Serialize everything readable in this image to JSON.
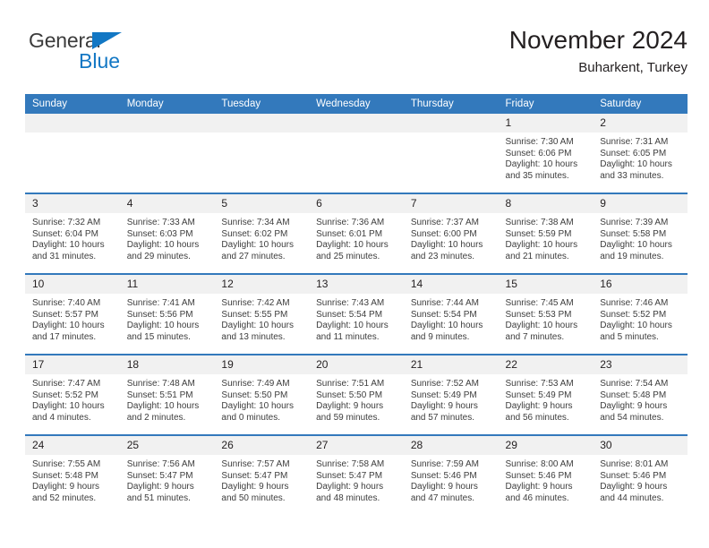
{
  "brand": {
    "name_top": "General",
    "name_bottom": "Blue",
    "triangle_color": "#1277c4",
    "text_color": "#3b3b3b",
    "accent_color": "#1277c4"
  },
  "header": {
    "month_year": "November 2024",
    "location": "Buharkent, Turkey"
  },
  "theme": {
    "header_bg": "#3379bc",
    "header_text": "#ffffff",
    "daynum_bg": "#f1f1f1",
    "row_border": "#3379bc",
    "body_text": "#3d3d3d"
  },
  "weekday_headers": [
    "Sunday",
    "Monday",
    "Tuesday",
    "Wednesday",
    "Thursday",
    "Friday",
    "Saturday"
  ],
  "weeks": [
    [
      {
        "day": "",
        "empty": true
      },
      {
        "day": "",
        "empty": true
      },
      {
        "day": "",
        "empty": true
      },
      {
        "day": "",
        "empty": true
      },
      {
        "day": "",
        "empty": true
      },
      {
        "day": "1",
        "sunrise": "Sunrise: 7:30 AM",
        "sunset": "Sunset: 6:06 PM",
        "daylight": "Daylight: 10 hours and 35 minutes."
      },
      {
        "day": "2",
        "sunrise": "Sunrise: 7:31 AM",
        "sunset": "Sunset: 6:05 PM",
        "daylight": "Daylight: 10 hours and 33 minutes."
      }
    ],
    [
      {
        "day": "3",
        "sunrise": "Sunrise: 7:32 AM",
        "sunset": "Sunset: 6:04 PM",
        "daylight": "Daylight: 10 hours and 31 minutes."
      },
      {
        "day": "4",
        "sunrise": "Sunrise: 7:33 AM",
        "sunset": "Sunset: 6:03 PM",
        "daylight": "Daylight: 10 hours and 29 minutes."
      },
      {
        "day": "5",
        "sunrise": "Sunrise: 7:34 AM",
        "sunset": "Sunset: 6:02 PM",
        "daylight": "Daylight: 10 hours and 27 minutes."
      },
      {
        "day": "6",
        "sunrise": "Sunrise: 7:36 AM",
        "sunset": "Sunset: 6:01 PM",
        "daylight": "Daylight: 10 hours and 25 minutes."
      },
      {
        "day": "7",
        "sunrise": "Sunrise: 7:37 AM",
        "sunset": "Sunset: 6:00 PM",
        "daylight": "Daylight: 10 hours and 23 minutes."
      },
      {
        "day": "8",
        "sunrise": "Sunrise: 7:38 AM",
        "sunset": "Sunset: 5:59 PM",
        "daylight": "Daylight: 10 hours and 21 minutes."
      },
      {
        "day": "9",
        "sunrise": "Sunrise: 7:39 AM",
        "sunset": "Sunset: 5:58 PM",
        "daylight": "Daylight: 10 hours and 19 minutes."
      }
    ],
    [
      {
        "day": "10",
        "sunrise": "Sunrise: 7:40 AM",
        "sunset": "Sunset: 5:57 PM",
        "daylight": "Daylight: 10 hours and 17 minutes."
      },
      {
        "day": "11",
        "sunrise": "Sunrise: 7:41 AM",
        "sunset": "Sunset: 5:56 PM",
        "daylight": "Daylight: 10 hours and 15 minutes."
      },
      {
        "day": "12",
        "sunrise": "Sunrise: 7:42 AM",
        "sunset": "Sunset: 5:55 PM",
        "daylight": "Daylight: 10 hours and 13 minutes."
      },
      {
        "day": "13",
        "sunrise": "Sunrise: 7:43 AM",
        "sunset": "Sunset: 5:54 PM",
        "daylight": "Daylight: 10 hours and 11 minutes."
      },
      {
        "day": "14",
        "sunrise": "Sunrise: 7:44 AM",
        "sunset": "Sunset: 5:54 PM",
        "daylight": "Daylight: 10 hours and 9 minutes."
      },
      {
        "day": "15",
        "sunrise": "Sunrise: 7:45 AM",
        "sunset": "Sunset: 5:53 PM",
        "daylight": "Daylight: 10 hours and 7 minutes."
      },
      {
        "day": "16",
        "sunrise": "Sunrise: 7:46 AM",
        "sunset": "Sunset: 5:52 PM",
        "daylight": "Daylight: 10 hours and 5 minutes."
      }
    ],
    [
      {
        "day": "17",
        "sunrise": "Sunrise: 7:47 AM",
        "sunset": "Sunset: 5:52 PM",
        "daylight": "Daylight: 10 hours and 4 minutes."
      },
      {
        "day": "18",
        "sunrise": "Sunrise: 7:48 AM",
        "sunset": "Sunset: 5:51 PM",
        "daylight": "Daylight: 10 hours and 2 minutes."
      },
      {
        "day": "19",
        "sunrise": "Sunrise: 7:49 AM",
        "sunset": "Sunset: 5:50 PM",
        "daylight": "Daylight: 10 hours and 0 minutes."
      },
      {
        "day": "20",
        "sunrise": "Sunrise: 7:51 AM",
        "sunset": "Sunset: 5:50 PM",
        "daylight": "Daylight: 9 hours and 59 minutes."
      },
      {
        "day": "21",
        "sunrise": "Sunrise: 7:52 AM",
        "sunset": "Sunset: 5:49 PM",
        "daylight": "Daylight: 9 hours and 57 minutes."
      },
      {
        "day": "22",
        "sunrise": "Sunrise: 7:53 AM",
        "sunset": "Sunset: 5:49 PM",
        "daylight": "Daylight: 9 hours and 56 minutes."
      },
      {
        "day": "23",
        "sunrise": "Sunrise: 7:54 AM",
        "sunset": "Sunset: 5:48 PM",
        "daylight": "Daylight: 9 hours and 54 minutes."
      }
    ],
    [
      {
        "day": "24",
        "sunrise": "Sunrise: 7:55 AM",
        "sunset": "Sunset: 5:48 PM",
        "daylight": "Daylight: 9 hours and 52 minutes."
      },
      {
        "day": "25",
        "sunrise": "Sunrise: 7:56 AM",
        "sunset": "Sunset: 5:47 PM",
        "daylight": "Daylight: 9 hours and 51 minutes."
      },
      {
        "day": "26",
        "sunrise": "Sunrise: 7:57 AM",
        "sunset": "Sunset: 5:47 PM",
        "daylight": "Daylight: 9 hours and 50 minutes."
      },
      {
        "day": "27",
        "sunrise": "Sunrise: 7:58 AM",
        "sunset": "Sunset: 5:47 PM",
        "daylight": "Daylight: 9 hours and 48 minutes."
      },
      {
        "day": "28",
        "sunrise": "Sunrise: 7:59 AM",
        "sunset": "Sunset: 5:46 PM",
        "daylight": "Daylight: 9 hours and 47 minutes."
      },
      {
        "day": "29",
        "sunrise": "Sunrise: 8:00 AM",
        "sunset": "Sunset: 5:46 PM",
        "daylight": "Daylight: 9 hours and 46 minutes."
      },
      {
        "day": "30",
        "sunrise": "Sunrise: 8:01 AM",
        "sunset": "Sunset: 5:46 PM",
        "daylight": "Daylight: 9 hours and 44 minutes."
      }
    ]
  ]
}
